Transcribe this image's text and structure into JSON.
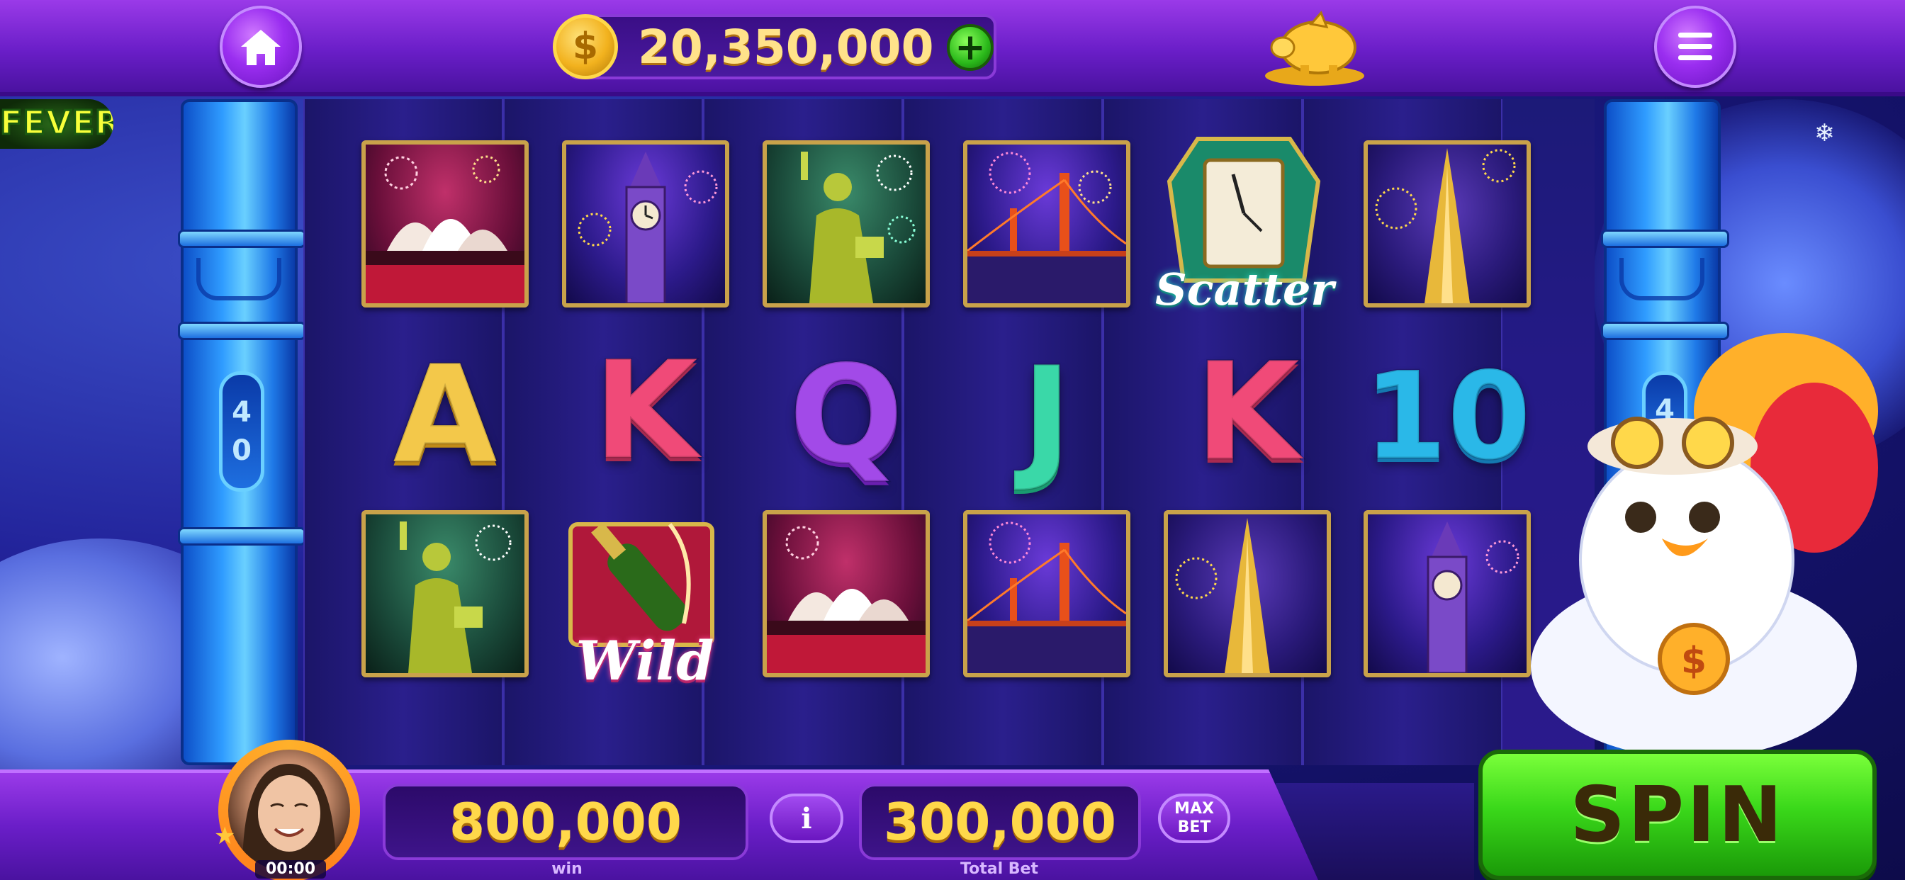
{
  "top_bar": {
    "balance": "20,350,000",
    "coin_symbol": "$",
    "add_coins_symbol": "+"
  },
  "game": {
    "logo_text": "FEVER",
    "pillar_left_badge": [
      "4",
      "0"
    ],
    "pillar_right_badge": [
      "4"
    ],
    "reels": [
      [
        "opera-house",
        "A",
        "statue-of-liberty"
      ],
      [
        "big-ben",
        "K",
        "wild"
      ],
      [
        "statue-of-liberty",
        "Q",
        "opera-house"
      ],
      [
        "golden-gate-bridge",
        "J",
        "golden-gate-bridge"
      ],
      [
        "scatter",
        "K",
        "burj-khalifa"
      ],
      [
        "burj-khalifa",
        "10",
        "big-ben"
      ]
    ],
    "scatter_label": "Scatter",
    "wild_label": "Wild",
    "letters": {
      "a": "A",
      "k1": "K",
      "q": "Q",
      "j": "J",
      "k2": "K",
      "ten": "10"
    }
  },
  "bottom_bar": {
    "win_value": "800,000",
    "win_label": "win",
    "info_label": "i",
    "total_bet_value": "300,000",
    "total_bet_label": "Total Bet",
    "max_bet_line1": "MAX",
    "max_bet_line2": "BET",
    "spin_label": "SPIN",
    "timer": "00:00"
  },
  "colors": {
    "accent_purple": "#7a22d8",
    "spin_green": "#3ad81a",
    "gold_text": "#ffd84a"
  }
}
